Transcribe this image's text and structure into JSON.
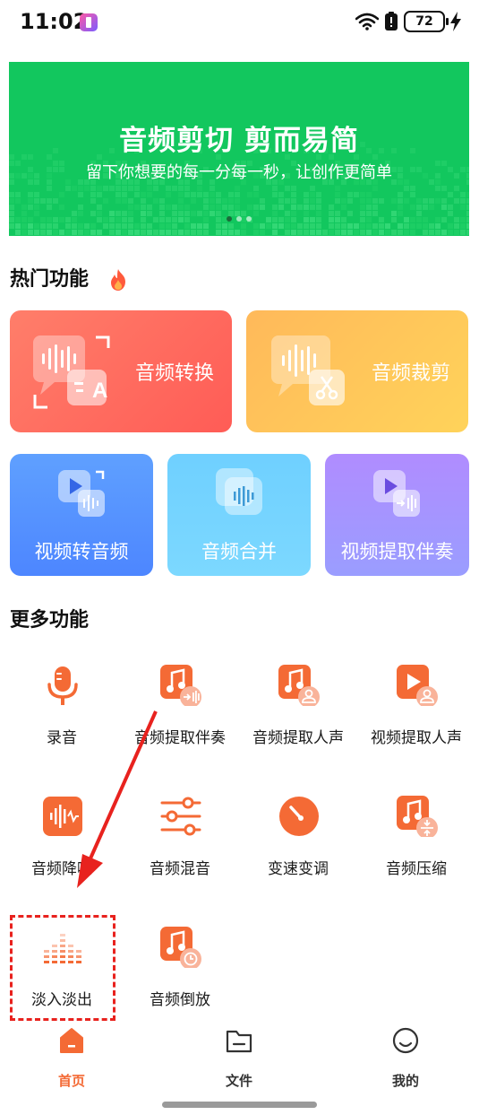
{
  "status_bar": {
    "time": "11:02",
    "battery_level": "72"
  },
  "banner": {
    "title": "音频剪切 剪而易简",
    "subtitle": "留下你想要的每一分每一秒，让创作更简单",
    "page_count": 3,
    "active_page": 1
  },
  "hot_section": {
    "title": "热门功能",
    "cards": [
      {
        "label": "音频转换",
        "icon": "audio-convert-icon"
      },
      {
        "label": "音频裁剪",
        "icon": "audio-cut-icon"
      },
      {
        "label": "视频转音频",
        "icon": "video-to-audio-icon"
      },
      {
        "label": "音频合并",
        "icon": "audio-merge-icon"
      },
      {
        "label": "视频提取伴奏",
        "icon": "video-extract-accompaniment-icon"
      }
    ]
  },
  "more_section": {
    "title": "更多功能",
    "items": [
      {
        "label": "录音",
        "icon": "microphone-icon"
      },
      {
        "label": "音频提取伴奏",
        "icon": "audio-extract-accompaniment-icon"
      },
      {
        "label": "音频提取人声",
        "icon": "audio-extract-vocal-icon"
      },
      {
        "label": "视频提取人声",
        "icon": "video-extract-vocal-icon"
      },
      {
        "label": "音频降噪",
        "icon": "noise-reduction-icon"
      },
      {
        "label": "音频混音",
        "icon": "mixer-icon"
      },
      {
        "label": "变速变调",
        "icon": "speed-pitch-icon"
      },
      {
        "label": "音频压缩",
        "icon": "audio-compress-icon"
      },
      {
        "label": "淡入淡出",
        "icon": "fade-in-out-icon"
      },
      {
        "label": "音频倒放",
        "icon": "audio-reverse-icon"
      }
    ]
  },
  "bottom_nav": {
    "items": [
      {
        "label": "首页",
        "icon": "home-icon",
        "active": true
      },
      {
        "label": "文件",
        "icon": "folder-icon",
        "active": false
      },
      {
        "label": "我的",
        "icon": "profile-icon",
        "active": false
      }
    ]
  },
  "colors": {
    "banner_green": "#12c75e",
    "accent_orange": "#f46a35",
    "annotation_red": "#e8221e"
  }
}
